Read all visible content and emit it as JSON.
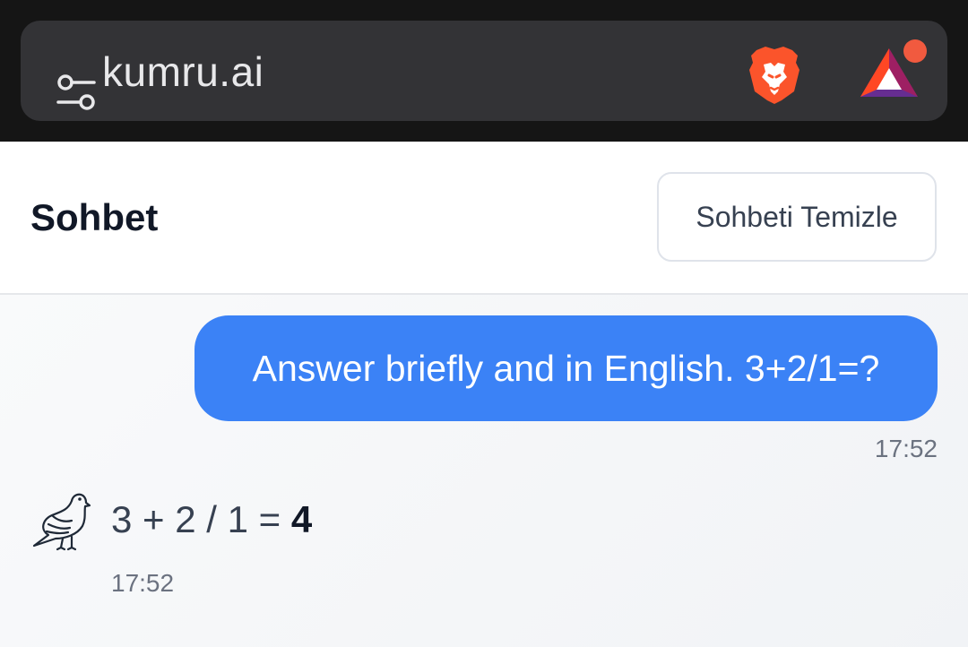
{
  "browser": {
    "url": "kumru.ai",
    "icons": [
      "site-settings-icon",
      "brave-shields-icon",
      "brave-rewards-icon"
    ],
    "rewards_badge_color": "#f15a3f"
  },
  "header": {
    "title": "Sohbet",
    "clear_button": "Sohbeti Temizle"
  },
  "messages": [
    {
      "role": "user",
      "text": "Answer briefly and in English. 3+2/1=?",
      "time": "17:52"
    },
    {
      "role": "assistant",
      "avatar": "dove-icon",
      "prefix": "3 + 2 / 1 = ",
      "answer": "4",
      "time": "17:52"
    }
  ],
  "colors": {
    "accent": "#3b82f6",
    "header_bg": "#ffffff",
    "chat_bg": "#f3f4f6",
    "browser_bg": "#151515"
  }
}
